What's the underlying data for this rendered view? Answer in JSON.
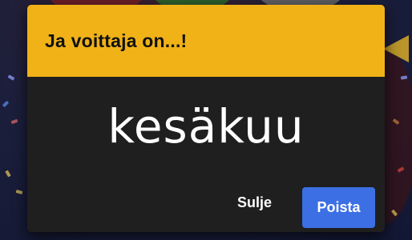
{
  "dialog": {
    "title": "Ja voittaja on...!",
    "winner": "kesäkuu",
    "close_label": "Sulje",
    "remove_label": "Poista"
  },
  "colors": {
    "header": "#f0b217",
    "dialog_bg": "#1f1f1f",
    "primary_button": "#3c6fe4",
    "backdrop": "#141a33"
  }
}
